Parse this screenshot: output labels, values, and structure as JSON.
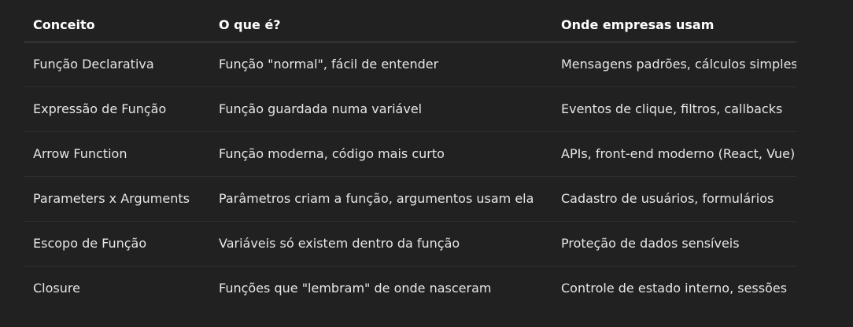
{
  "table": {
    "headers": [
      "Conceito",
      "O que é?",
      "Onde empresas usam"
    ],
    "rows": [
      [
        "Função Declarativa",
        "Função \"normal\", fácil de entender",
        "Mensagens padrões, cálculos simples"
      ],
      [
        "Expressão de Função",
        "Função guardada numa variável",
        "Eventos de clique, filtros, callbacks"
      ],
      [
        "Arrow Function",
        "Função moderna, código mais curto",
        "APIs, front-end moderno (React, Vue)"
      ],
      [
        "Parameters x Arguments",
        "Parâmetros criam a função, argumentos usam ela",
        "Cadastro de usuários, formulários"
      ],
      [
        "Escopo de Função",
        "Variáveis só existem dentro da função",
        "Proteção de dados sensíveis"
      ],
      [
        "Closure",
        "Funções que \"lembram\" de onde nasceram",
        "Controle de estado interno, sessões"
      ]
    ]
  }
}
